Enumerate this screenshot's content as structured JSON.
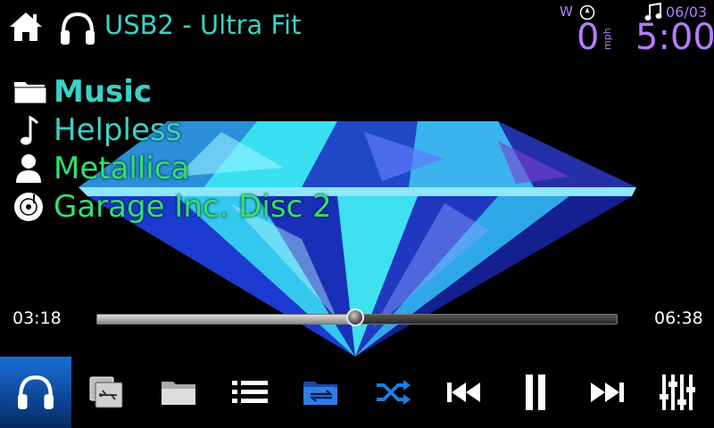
{
  "header": {
    "source_title": "USB2 - Ultra Fit",
    "compass_direction": "W",
    "speed": "0",
    "speed_unit": "mph",
    "date": "06/03",
    "clock": "5:00"
  },
  "now_playing": {
    "category": "Music",
    "track": "Helpless",
    "artist": "Metallica",
    "album": "Garage Inc. Disc 2"
  },
  "progress": {
    "elapsed": "03:18",
    "total": "06:38",
    "fraction": 0.497
  },
  "bottom_bar": {
    "buttons": [
      "now-playing",
      "usb-source",
      "browse-folder",
      "list",
      "repeat-folder",
      "shuffle",
      "previous",
      "pause",
      "next",
      "equalizer"
    ]
  },
  "colors": {
    "accent_teal": "#3ad2c6",
    "accent_green": "#31e071",
    "accent_purple": "#b57cff",
    "active_tab": "#1a6ed8",
    "control_blue": "#1e7ddc"
  }
}
